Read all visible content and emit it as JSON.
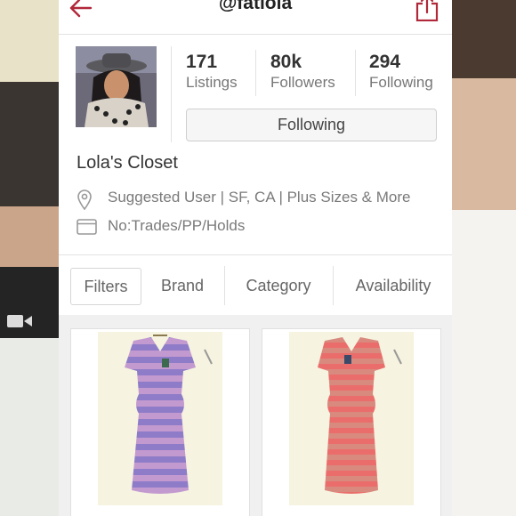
{
  "header": {
    "handle": "@fatlola"
  },
  "profile": {
    "stats": [
      {
        "value": "171",
        "label": "Listings"
      },
      {
        "value": "80k",
        "label": "Followers"
      },
      {
        "value": "294",
        "label": "Following"
      }
    ],
    "follow_button_label": "Following",
    "closet_name": "Lola's Closet",
    "location_line": "Suggested User | SF, CA | Plus Sizes & More",
    "policy_line": "No:Trades/PP/Holds"
  },
  "filters": {
    "tabs": [
      "Filters",
      "Brand",
      "Category",
      "Availability"
    ]
  },
  "listings": [
    {
      "item": "purple-striped-dress",
      "color": "#9b7fc4"
    },
    {
      "item": "coral-striped-dress",
      "color": "#e8726e"
    }
  ],
  "colors": {
    "accent": "#b0283a",
    "text": "#333333",
    "muted": "#777777"
  }
}
